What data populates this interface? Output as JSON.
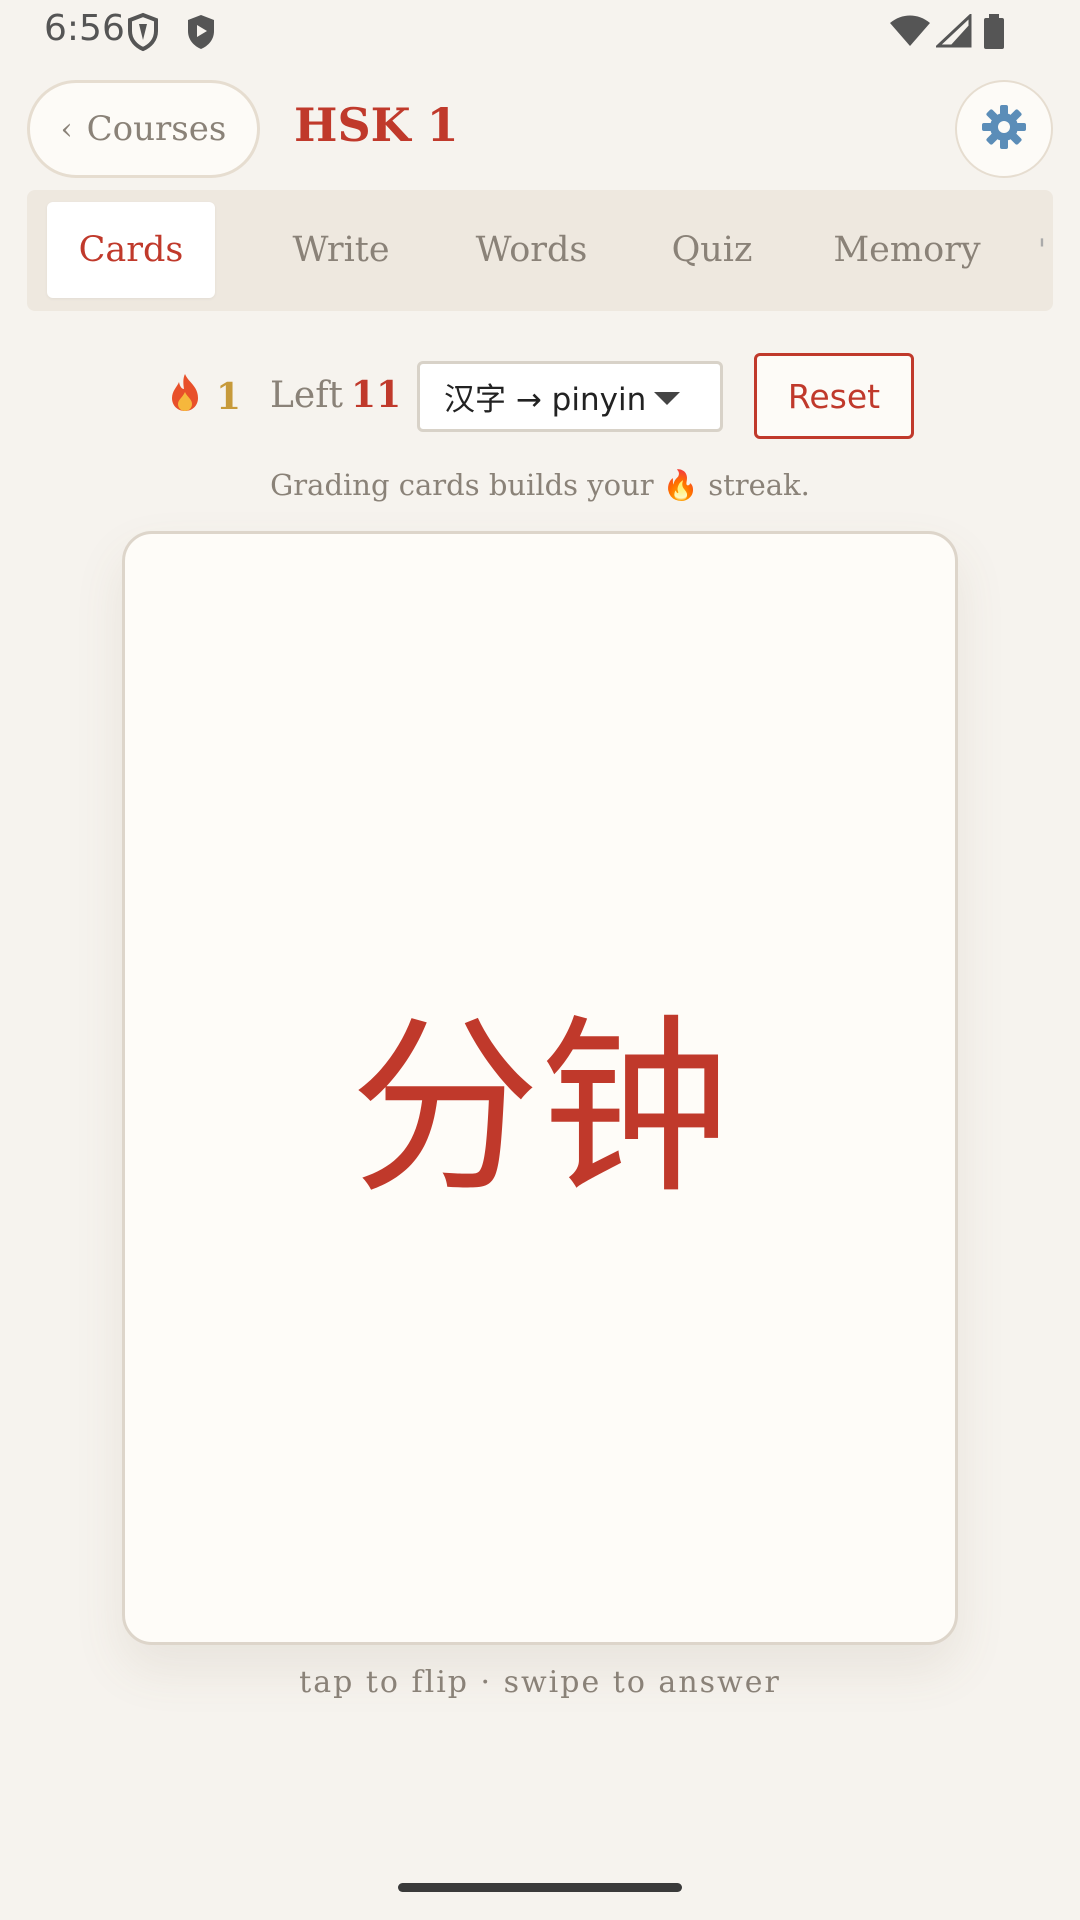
{
  "status_bar": {
    "time": "6:56"
  },
  "header": {
    "back_label": "Courses",
    "title": "HSK 1"
  },
  "tabs": [
    {
      "label": "Cards",
      "active": true
    },
    {
      "label": "Write"
    },
    {
      "label": "Words"
    },
    {
      "label": "Quiz"
    },
    {
      "label": "Memory"
    }
  ],
  "stats": {
    "streak_count": "1",
    "left_label": "Left",
    "left_count": "11"
  },
  "mode_select": {
    "selected": "汉字 → pinyin"
  },
  "reset_label": "Reset",
  "hint_streak": "Grading cards builds your 🔥 streak.",
  "card": {
    "hanzi": "分钟"
  },
  "hint_flip": "tap to flip · swipe to answer",
  "colors": {
    "accent": "#c0392b",
    "streak": "#c79a3a",
    "background": "#f6f3ee",
    "muted_text": "#8a8278"
  },
  "icons": {
    "status": [
      "shield-outline-icon",
      "shield-play-icon",
      "wifi-icon",
      "signal-icon",
      "battery-icon"
    ],
    "settings": "gear-icon",
    "back": "chevron-left-icon",
    "streak": "flame-icon",
    "dropdown": "caret-down-icon"
  }
}
